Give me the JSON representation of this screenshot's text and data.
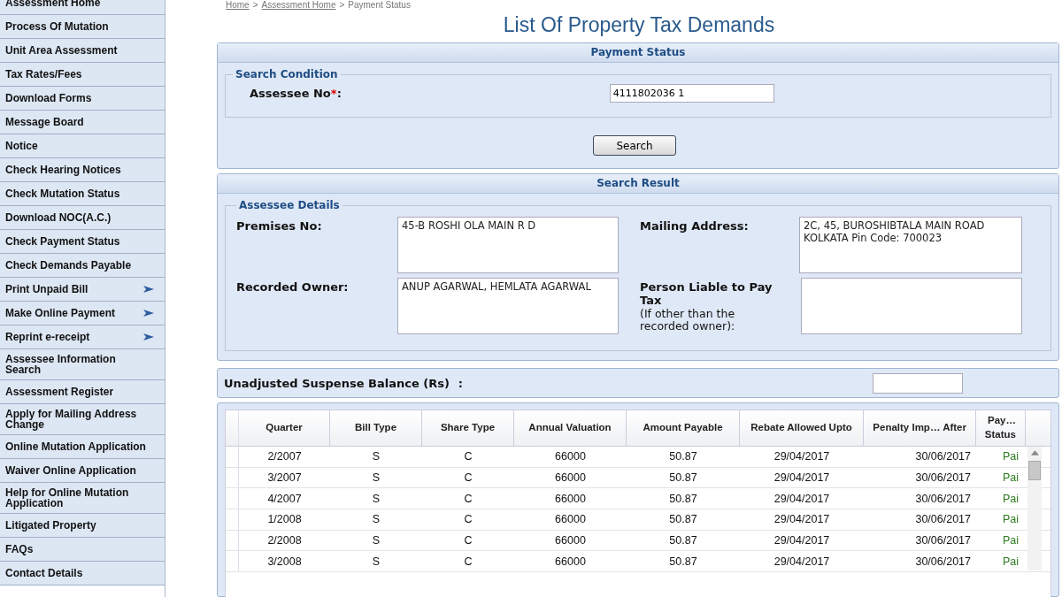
{
  "sidebar": {
    "items": [
      {
        "label": "Assessment Home",
        "submenu": false
      },
      {
        "label": "Process Of Mutation",
        "submenu": false
      },
      {
        "label": "Unit Area Assessment",
        "submenu": false
      },
      {
        "label": "Tax Rates/Fees",
        "submenu": false
      },
      {
        "label": "Download Forms",
        "submenu": false
      },
      {
        "label": "Message Board",
        "submenu": false
      },
      {
        "label": "Notice",
        "submenu": false
      },
      {
        "label": "Check Hearing Notices",
        "submenu": false
      },
      {
        "label": "Check Mutation Status",
        "submenu": false
      },
      {
        "label": "Download NOC(A.C.)",
        "submenu": false
      },
      {
        "label": "Check Payment Status",
        "submenu": false
      },
      {
        "label": "Check Demands Payable",
        "submenu": false
      },
      {
        "label": "Print Unpaid Bill",
        "submenu": true
      },
      {
        "label": "Make Online Payment",
        "submenu": true
      },
      {
        "label": "Reprint e-receipt",
        "submenu": true
      },
      {
        "label": "Assessee Information Search",
        "submenu": false
      },
      {
        "label": "Assessment Register",
        "submenu": false
      },
      {
        "label": "Apply for Mailing Address Change",
        "submenu": false
      },
      {
        "label": "Online Mutation Application",
        "submenu": false
      },
      {
        "label": "Waiver Online Application",
        "submenu": false
      },
      {
        "label": "Help for Online Mutation Application",
        "submenu": false
      },
      {
        "label": "Litigated Property",
        "submenu": false
      },
      {
        "label": "FAQs",
        "submenu": false
      },
      {
        "label": "Contact Details",
        "submenu": false
      }
    ]
  },
  "breadcrumb": {
    "items": [
      "Home",
      "Assessment Home",
      "Payment Status"
    ],
    "separator": ">"
  },
  "page_title": "List Of Property Tax Demands",
  "payment_status": {
    "title": "Payment Status",
    "legend": "Search Condition",
    "label": "Assessee No",
    "required_mark": "*",
    "suffix": ":",
    "value": "4111802036 1",
    "button": "Search"
  },
  "search_result": {
    "title": "Search Result",
    "legend": "Assessee Details",
    "fields": [
      {
        "label": "Premises No:",
        "value": "45-B ROSHI OLA MAIN R D"
      },
      {
        "label": "Mailing Address:",
        "value": "2C, 45, BUROSHIBTALA MAIN ROAD KOLKATA Pin Code: 700023"
      },
      {
        "label": "Recorded Owner:",
        "value": "ANUP AGARWAL, HEMLATA AGARWAL"
      },
      {
        "label": "Person Liable to Pay Tax",
        "note": "(If other than the recorded owner):"
      }
    ]
  },
  "suspense": {
    "label": "Unadjusted Suspense Balance (Rs)",
    "colon": ":"
  },
  "table": {
    "columns": [
      "Quarter",
      "Bill Type",
      "Share Type",
      "Annual Valuation",
      "Amount Payable",
      "Rebate Allowed Upto",
      "Penalty Imp… After",
      "Pay… Status"
    ],
    "rows": [
      [
        "2/2007",
        "S",
        "C",
        "66000",
        "50.87",
        "29/04/2017",
        "30/06/2017",
        "Pai"
      ],
      [
        "3/2007",
        "S",
        "C",
        "66000",
        "50.87",
        "29/04/2017",
        "30/06/2017",
        "Pai"
      ],
      [
        "4/2007",
        "S",
        "C",
        "66000",
        "50.87",
        "29/04/2017",
        "30/06/2017",
        "Pai"
      ],
      [
        "1/2008",
        "S",
        "C",
        "66000",
        "50.87",
        "29/04/2017",
        "30/06/2017",
        "Pai"
      ],
      [
        "2/2008",
        "S",
        "C",
        "66000",
        "50.87",
        "29/04/2017",
        "30/06/2017",
        "Pai"
      ],
      [
        "3/2008",
        "S",
        "C",
        "66000",
        "50.87",
        "29/04/2017",
        "30/06/2017",
        "Pai"
      ]
    ]
  }
}
